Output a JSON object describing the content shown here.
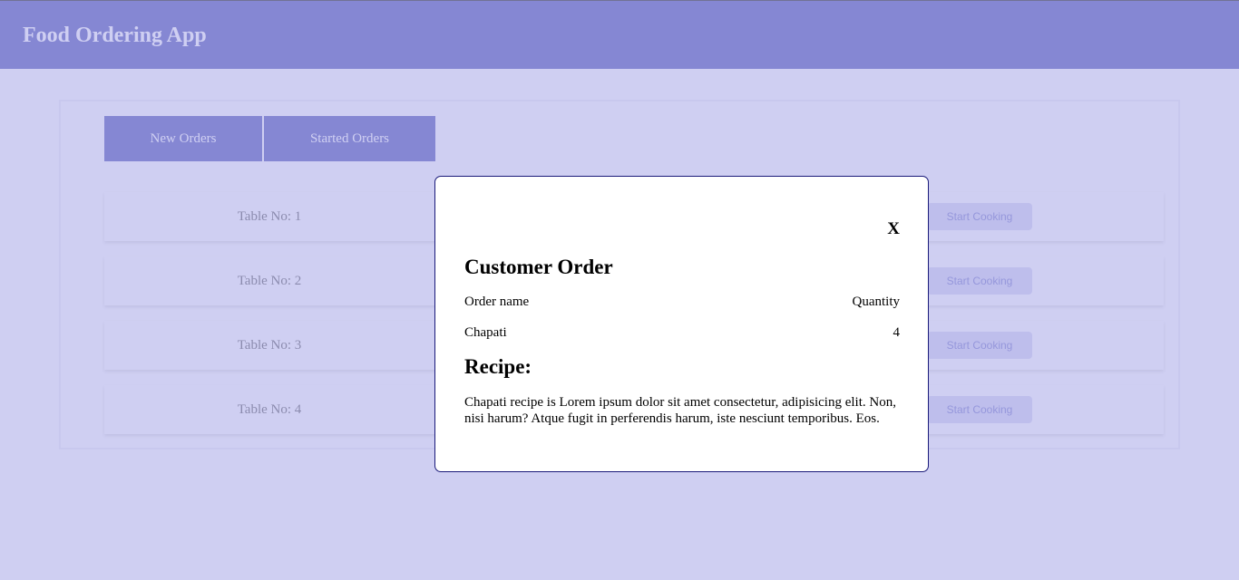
{
  "header": {
    "title": "Food Ordering App"
  },
  "tabs": [
    {
      "label": "New Orders"
    },
    {
      "label": "Started Orders"
    }
  ],
  "orders": [
    {
      "table_label": "Table No: 1",
      "action_label": "Start Cooking"
    },
    {
      "table_label": "Table No: 2",
      "action_label": "Start Cooking"
    },
    {
      "table_label": "Table No: 3",
      "action_label": "Start Cooking"
    },
    {
      "table_label": "Table No: 4",
      "action_label": "Start Cooking"
    }
  ],
  "modal": {
    "close_label": "X",
    "title": "Customer Order",
    "columns": {
      "name": "Order name",
      "quantity": "Quantity"
    },
    "items": [
      {
        "name": "Chapati",
        "quantity": "4"
      }
    ],
    "recipe_heading": "Recipe:",
    "recipe_text": "Chapati recipe is Lorem ipsum dolor sit amet consectetur, adipisicing elit. Non, nisi harum? Atque fugit in perferendis harum, iste nesciunt temporibus. Eos."
  },
  "colors": {
    "header_bg": "#6b6fc0",
    "overlay": "rgba(160,160,230,0.5)",
    "modal_border": "#1a1a7a"
  }
}
